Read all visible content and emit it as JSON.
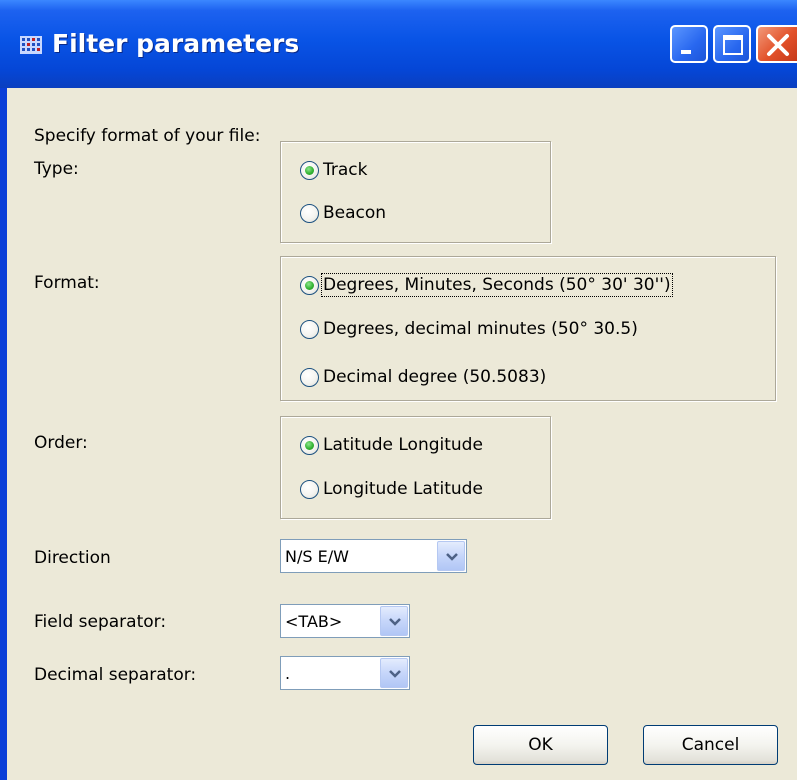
{
  "window": {
    "title": "Filter parameters"
  },
  "intro": "Specify format of your file:",
  "type": {
    "label": "Type:",
    "options": [
      {
        "label": "Track",
        "checked": true
      },
      {
        "label": "Beacon",
        "checked": false
      }
    ]
  },
  "format": {
    "label": "Format:",
    "options": [
      {
        "label": "Degrees, Minutes, Seconds (50° 30' 30'')",
        "checked": true
      },
      {
        "label": "Degrees, decimal minutes (50° 30.5)",
        "checked": false
      },
      {
        "label": "Decimal degree (50.5083)",
        "checked": false
      }
    ]
  },
  "order": {
    "label": "Order:",
    "options": [
      {
        "label": "Latitude Longitude",
        "checked": true
      },
      {
        "label": "Longitude Latitude",
        "checked": false
      }
    ]
  },
  "direction": {
    "label": "Direction",
    "value": "N/S E/W"
  },
  "field_separator": {
    "label": "Field separator:",
    "value": "<TAB>"
  },
  "decimal_separator": {
    "label": "Decimal separator:",
    "value": "."
  },
  "buttons": {
    "ok": "OK",
    "cancel": "Cancel"
  },
  "colors": {
    "titlebar": "#0954e6",
    "dialog_bg": "#ece9d8",
    "radio_checked": "#35b535"
  }
}
